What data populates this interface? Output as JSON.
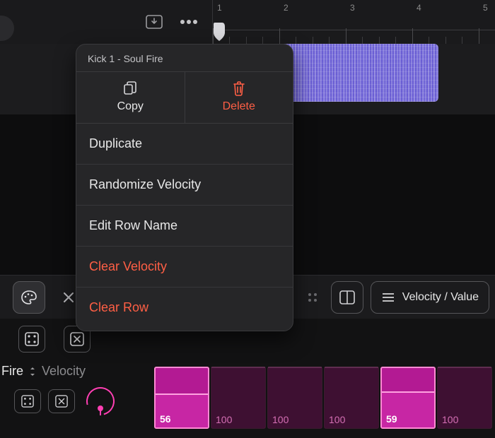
{
  "ruler": {
    "ticks": [
      "1",
      "2",
      "3",
      "4",
      "5"
    ]
  },
  "region": {
    "label": ""
  },
  "context_menu": {
    "title": "Kick 1 - Soul Fire",
    "copy_label": "Copy",
    "delete_label": "Delete",
    "items": [
      {
        "label": "Duplicate",
        "danger": false
      },
      {
        "label": "Randomize Velocity",
        "danger": false
      },
      {
        "label": "Edit Row Name",
        "danger": false
      },
      {
        "label": "Clear Velocity",
        "danger": true
      },
      {
        "label": "Clear Row",
        "danger": true
      }
    ]
  },
  "midbar": {
    "mode_label": "Velocity / Value"
  },
  "bottom": {
    "track_label": "Fire",
    "param_label": "Velocity",
    "cells": [
      {
        "value": "56",
        "active": true,
        "height_pct": 56
      },
      {
        "value": "100",
        "active": false,
        "height_pct": 100
      },
      {
        "value": "100",
        "active": false,
        "height_pct": 100
      },
      {
        "value": "100",
        "active": false,
        "height_pct": 100
      },
      {
        "value": "59",
        "active": true,
        "height_pct": 59
      },
      {
        "value": "100",
        "active": false,
        "height_pct": 100
      }
    ]
  },
  "colors": {
    "accent_pink": "#ff3fb3",
    "accent_purple": "#6a5ed4",
    "danger": "#ff5f45"
  }
}
